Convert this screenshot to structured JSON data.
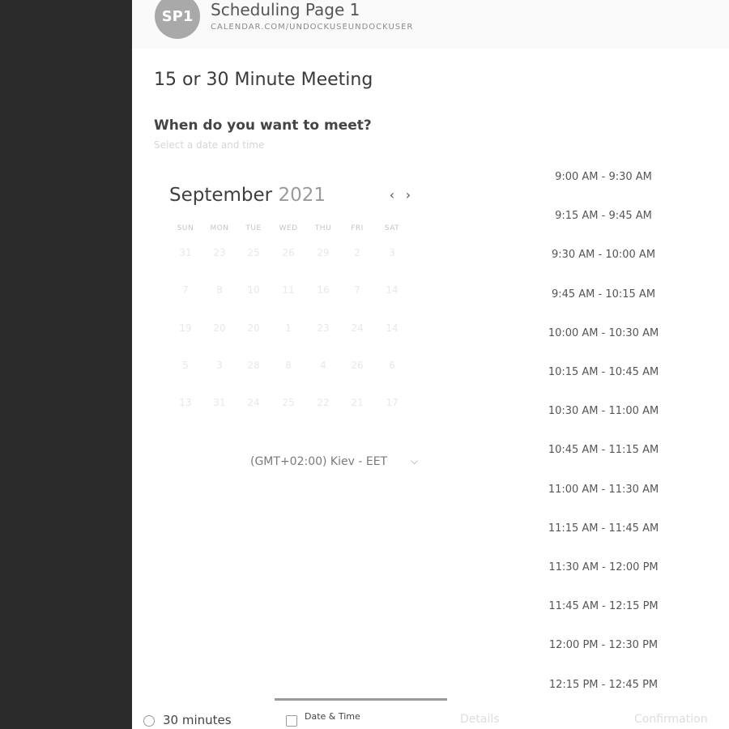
{
  "header": {
    "avatar_initials": "SP1",
    "title": "Scheduling Page 1",
    "url": "CALENDAR.COM/UNDOCKUSEUNDOCKUSER"
  },
  "meeting_title": "15 or 30 Minute Meeting",
  "question": {
    "title": "When do you want to meet?",
    "subtitle": "Select a date and time"
  },
  "calendar": {
    "month": "September",
    "year": "2021",
    "prev_icon": "‹",
    "next_icon": "›",
    "weekdays": [
      "SUN",
      "MON",
      "TUE",
      "WED",
      "THU",
      "FRI",
      "SAT"
    ],
    "weeks": [
      [
        "31",
        "23",
        "25",
        "26",
        "29",
        "2",
        "3"
      ],
      [
        "7",
        "8",
        "10",
        "11",
        "16",
        "7",
        "14"
      ],
      [
        "19",
        "20",
        "20",
        "1",
        "23",
        "24",
        "14"
      ],
      [
        "5",
        "3",
        "28",
        "8",
        "4",
        "26",
        "6"
      ],
      [
        "13",
        "31",
        "24",
        "25",
        "22",
        "21",
        "17"
      ]
    ]
  },
  "timezone": {
    "label": "(GMT+02:00) Kiev - EET",
    "chevron": "⌵"
  },
  "time_slots": [
    "9:00 AM - 9:30 AM",
    "9:15 AM - 9:45 AM",
    "9:30 AM - 10:00 AM",
    "9:45 AM - 10:15 AM",
    "10:00 AM - 10:30 AM",
    "10:15 AM - 10:45 AM",
    "10:30 AM - 11:00 AM",
    "10:45 AM - 11:15 AM",
    "11:00 AM - 11:30 AM",
    "11:15 AM - 11:45 AM",
    "11:30 AM - 12:00 PM",
    "11:45 AM - 12:15 PM",
    "12:00 PM - 12:30 PM",
    "12:15 PM - 12:45 PM"
  ],
  "bottom": {
    "duration": "30 minutes",
    "step_label": "Date & Time",
    "faded_1": "Details",
    "faded_2": "Confirmation"
  }
}
